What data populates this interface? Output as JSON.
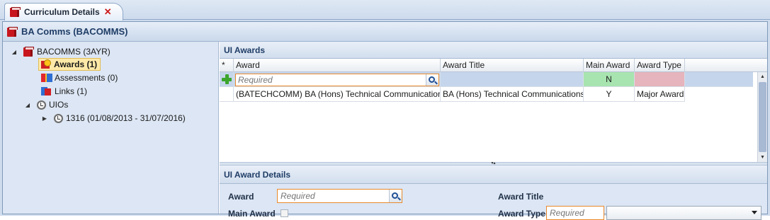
{
  "tab": {
    "label": "Curriculum Details",
    "close": "✕"
  },
  "panel": {
    "title": "BA Comms (BACOMMS)"
  },
  "tree": {
    "root": "BACOMMS (3AYR)",
    "awards": "Awards (1)",
    "assessments": "Assessments (0)",
    "links": "Links (1)",
    "uios": "UIOs",
    "uio_item": "1316 (01/08/2013 - 31/07/2016)"
  },
  "ui_awards": {
    "title": "UI Awards",
    "columns": [
      "*",
      "Award",
      "Award Title",
      "Main Award",
      "Award Type"
    ],
    "new_row": {
      "award_placeholder": "Required",
      "main_award": "N"
    },
    "rows": [
      {
        "award": "(BATECHCOMM) BA (Hons) Technical Communications",
        "award_title": "BA (Hons) Technical Communications",
        "main_award": "Y",
        "award_type": "Major Award"
      }
    ]
  },
  "details": {
    "title": "UI Award Details",
    "award_label": "Award",
    "award_placeholder": "Required",
    "main_award_label": "Main Award",
    "award_title_label": "Award Title",
    "award_type_label": "Award Type",
    "award_type_placeholder": "Required",
    "award_type_selected": ""
  },
  "colors": {
    "accent": "#1f3d66",
    "required_border": "#e98a2b",
    "new_row_bg": "#c5d6ec",
    "main_award_cell": "#a8e4b0",
    "award_type_cell": "#e6b4bc"
  }
}
